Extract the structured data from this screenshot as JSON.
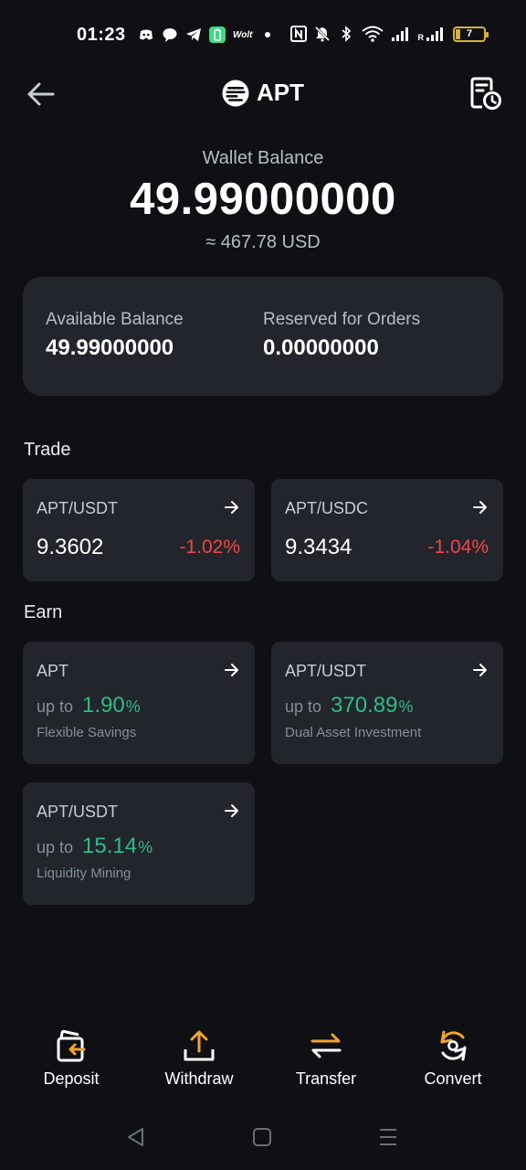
{
  "status_bar": {
    "time": "01:23",
    "wolt_label": "Wolt",
    "signal_label": "R",
    "battery_level": "7"
  },
  "header": {
    "title": "APT"
  },
  "wallet": {
    "label": "Wallet Balance",
    "value": "49.99000000",
    "usd": "≈ 467.78 USD"
  },
  "balances": {
    "available_label": "Available Balance",
    "available_value": "49.99000000",
    "reserved_label": "Reserved for Orders",
    "reserved_value": "0.00000000"
  },
  "trade": {
    "title": "Trade",
    "items": [
      {
        "pair": "APT/USDT",
        "price": "9.3602",
        "change": "-1.02%"
      },
      {
        "pair": "APT/USDC",
        "price": "9.3434",
        "change": "-1.04%"
      }
    ]
  },
  "earn": {
    "title": "Earn",
    "items": [
      {
        "pair": "APT",
        "upto": "up to",
        "rate": "1.90",
        "pct": "%",
        "product": "Flexible Savings"
      },
      {
        "pair": "APT/USDT",
        "upto": "up to",
        "rate": "370.89",
        "pct": "%",
        "product": "Dual Asset Investment"
      },
      {
        "pair": "APT/USDT",
        "upto": "up to",
        "rate": "15.14",
        "pct": "%",
        "product": "Liquidity Mining"
      }
    ]
  },
  "actions": {
    "deposit": "Deposit",
    "withdraw": "Withdraw",
    "transfer": "Transfer",
    "convert": "Convert"
  },
  "colors": {
    "background": "#101014",
    "card": "#22252b",
    "negative": "#f0454b",
    "positive": "#2ebd85",
    "accent": "#f0a22e"
  },
  "icons": [
    "back-arrow-icon",
    "apt-logo-icon",
    "history-icon",
    "arrow-right-icon",
    "deposit-icon",
    "withdraw-icon",
    "transfer-icon",
    "convert-icon"
  ]
}
